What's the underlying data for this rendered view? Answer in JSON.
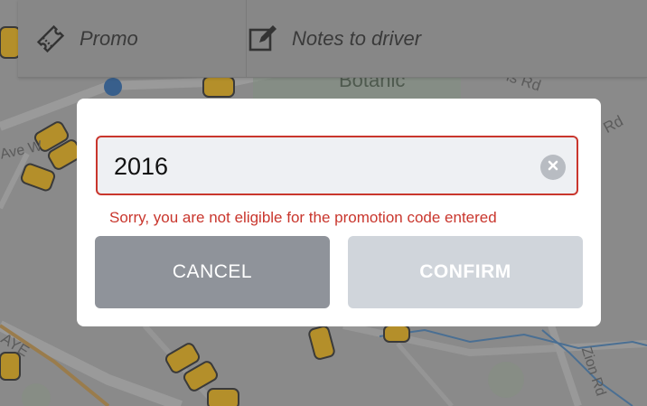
{
  "map": {
    "labels": {
      "botanic": "Botanic",
      "road_top": "is Rd",
      "road_right": "Rd",
      "avenue_left": "Ave W",
      "avenue_bottom": "AYE",
      "zion": "Zion Rd"
    }
  },
  "top_bar": {
    "promo_label": "Promo",
    "promo_icon": "ticket-icon",
    "notes_label": "Notes to driver",
    "notes_icon": "edit-note-icon"
  },
  "dialog": {
    "promo_code_value": "2016",
    "clear_icon": "clear-circle-icon",
    "error_message": "Sorry, you are not eligible for the promotion code entered",
    "cancel_label": "CANCEL",
    "confirm_label": "CONFIRM"
  },
  "colors": {
    "error": "#c9362d",
    "cancel_button": "#8f939a",
    "confirm_button_disabled": "#d0d5db",
    "field_background": "#eef0f3",
    "overlay_map": "#8a8a8a"
  }
}
